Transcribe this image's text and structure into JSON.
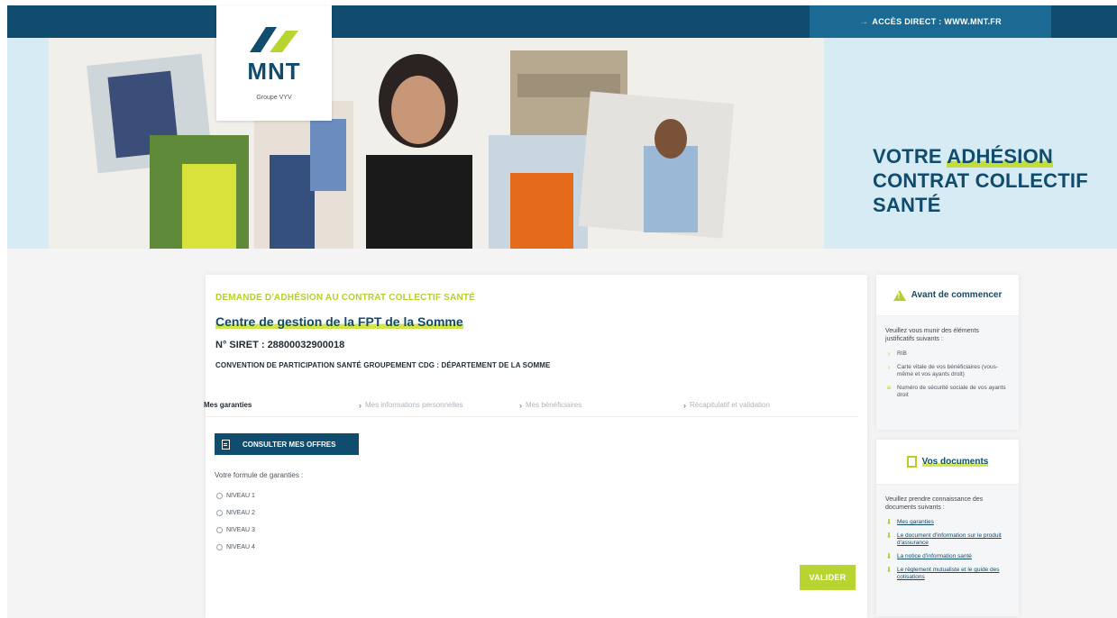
{
  "header": {
    "direct_access": "ACCÈS DIRECT : WWW.MNT.FR"
  },
  "logo": {
    "brand": "MNT",
    "group": "Groupe VYV"
  },
  "hero": {
    "line1_pre": "VOTRE ",
    "line1_hl": "ADHÉSION",
    "line2": "CONTRAT COLLECTIF",
    "line3": "SANTÉ"
  },
  "form": {
    "eyebrow": "DEMANDE D'ADHÉSION AU CONTRAT COLLECTIF SANTÉ",
    "org_name": "Centre de gestion de la FPT de la Somme",
    "siret": "N° SIRET : 28800032900018",
    "convention": "CONVENTION DE PARTICIPATION SANTÉ GROUPEMENT CDG : DÉPARTEMENT DE LA SOMME",
    "steps": [
      "Mes garanties",
      "Mes informations personnelles",
      "Mes bénéficiaires",
      "Récapitulatif et validation"
    ],
    "offers_button": "CONSULTER MES OFFRES",
    "formula_label": "Votre formule de garanties :",
    "options": [
      "NIVEAU 1",
      "NIVEAU 2",
      "NIVEAU 3",
      "NIVEAU 4"
    ],
    "validate_button": "VALIDER"
  },
  "sidebar_before": {
    "title": "Avant de commencer",
    "intro": "Veuillez vous munir des éléments justificatifs suivants :",
    "items": [
      "RIB",
      "Carte vitale de vos bénéficiaires (vous-même et vos ayants droit)",
      "Numéro de sécurité sociale de vos ayants droit"
    ]
  },
  "sidebar_docs": {
    "title": "Vos documents",
    "intro": "Veuillez prendre connaissance des documents suivants :",
    "items": [
      "Mes garanties",
      "Le document d'information sur le produit d'assurance",
      "La notice d'information santé",
      "Le règlement mutualiste et le guide des cotisations"
    ]
  },
  "colors": {
    "navy": "#0f4c6e",
    "lime": "#b7d431",
    "hero_bg": "#d6ebf3"
  }
}
